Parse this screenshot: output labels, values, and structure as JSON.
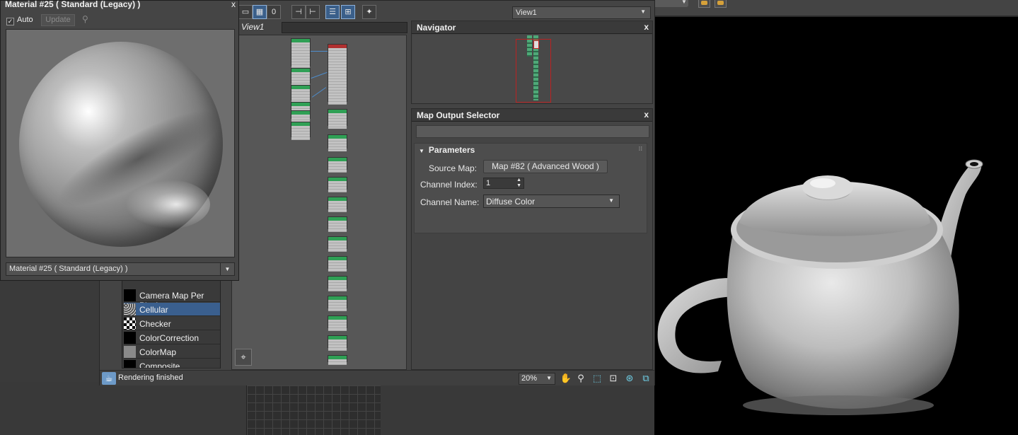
{
  "material_window": {
    "title": "Material #25  ( Standard (Legacy) )",
    "auto_label": "Auto",
    "auto_checked": true,
    "update_label": "Update",
    "material_selector_value": "Material #25  ( Standard (Legacy) )"
  },
  "slate_editor": {
    "view_tab": "View1",
    "view_select_value": "View1",
    "toolbar_icons": [
      "select-tool-icon",
      "checker-icon",
      "material-id-icon",
      "layout-icon",
      "move-children-icon",
      "list-icon",
      "grid-icon",
      "magic-wand-icon"
    ]
  },
  "map_browser": {
    "items": [
      {
        "label": "Camera Map Per Pixel",
        "thumb": "black"
      },
      {
        "label": "Cellular",
        "thumb": "cellular",
        "selected": true
      },
      {
        "label": "Checker",
        "thumb": "checker"
      },
      {
        "label": "ColorCorrection",
        "thumb": "black"
      },
      {
        "label": "ColorMap",
        "thumb": "gray"
      },
      {
        "label": "Composite",
        "thumb": "black"
      }
    ]
  },
  "navigator": {
    "title": "Navigator"
  },
  "map_output_selector": {
    "title": "Map Output Selector",
    "rollout_title": "Parameters",
    "source_map_label": "Source Map:",
    "source_map_value": "Map #82  ( Advanced Wood )",
    "channel_index_label": "Channel Index:",
    "channel_index_value": "1",
    "channel_name_label": "Channel Name:",
    "channel_name_value": "Diffuse Color"
  },
  "status_bar": {
    "message": "Rendering finished",
    "zoom_value": "20%"
  },
  "viewport": {
    "background": "#000000"
  },
  "colors": {
    "selected_item": "#3a5f8e",
    "node_header": "#2fa055",
    "navigator_frame": "#bb2222",
    "wire": "#4d8ccc"
  }
}
